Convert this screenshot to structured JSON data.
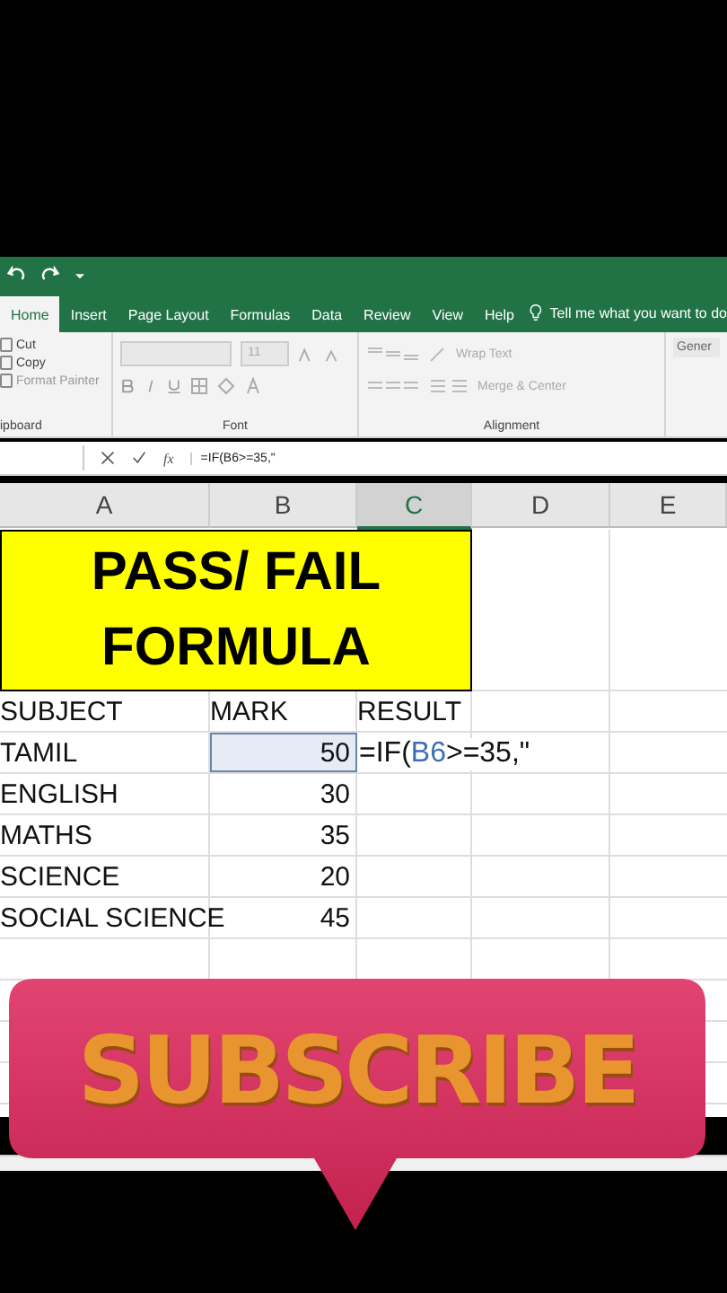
{
  "ribbon_tabs": [
    {
      "label": "Home",
      "selected": true
    },
    {
      "label": "Insert",
      "selected": false
    },
    {
      "label": "Page Layout",
      "selected": false
    },
    {
      "label": "Formulas",
      "selected": false
    },
    {
      "label": "Data",
      "selected": false
    },
    {
      "label": "Review",
      "selected": false
    },
    {
      "label": "View",
      "selected": false
    },
    {
      "label": "Help",
      "selected": false
    }
  ],
  "tell_me": "Tell me what you want to do",
  "clipboard": {
    "buttons": [
      "Cut",
      "Copy",
      "Format Painter"
    ],
    "group_label": "ipboard"
  },
  "font": {
    "size": "11",
    "group_label": "Font"
  },
  "alignment": {
    "wrap_text": "Wrap Text",
    "merge_center": "Merge & Center",
    "group_label": "Alignment"
  },
  "number_format": "Gener",
  "formula_bar": {
    "fx_label": "fx",
    "formula": "=IF(B6>=35,\""
  },
  "columns": [
    "A",
    "B",
    "C",
    "D",
    "E"
  ],
  "title_cell": {
    "lines": [
      "PASS/ FAIL",
      "FORMULA"
    ]
  },
  "header_row": [
    "SUBJECT",
    "MARK",
    "RESULT"
  ],
  "rows": [
    {
      "subject": "TAMIL",
      "mark": "50",
      "selected": true,
      "editing": [
        {
          "text": "=IF(",
          "kind": "plain"
        },
        {
          "text": "B6",
          "kind": "reference"
        },
        {
          "text": ">=35,\"",
          "kind": "plain"
        }
      ]
    },
    {
      "subject": "ENGLISH",
      "mark": "30",
      "selected": false
    },
    {
      "subject": "MATHS",
      "mark": "35",
      "selected": false
    },
    {
      "subject": "SCIENCE",
      "mark": "20",
      "selected": false
    },
    {
      "subject": "SOCIAL  SCIENCE",
      "mark": "45",
      "selected": false
    }
  ],
  "sticker": {
    "text": "SUBSCRIBE"
  }
}
